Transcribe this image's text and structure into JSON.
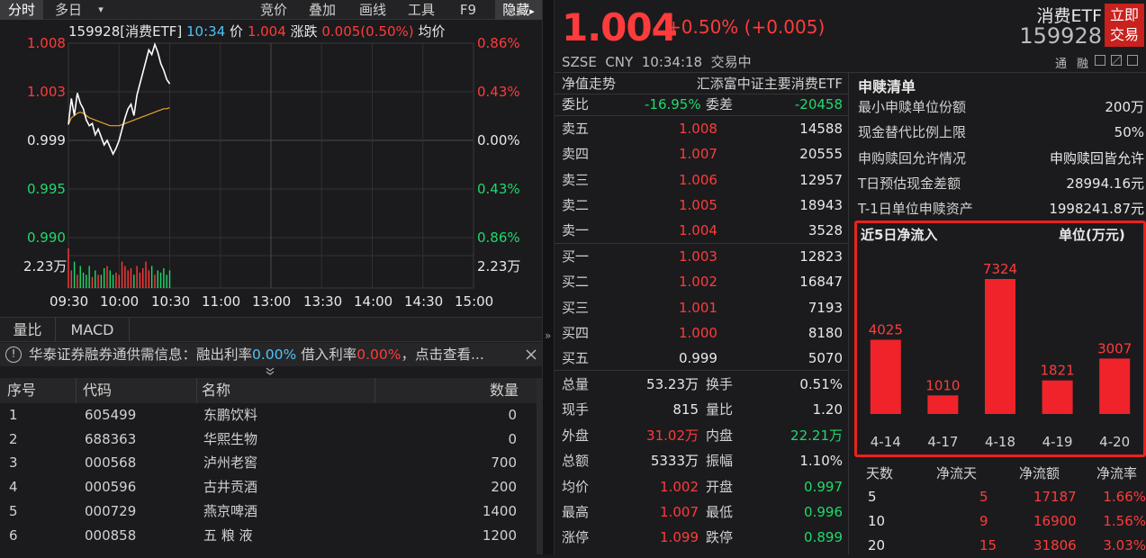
{
  "toolbar": {
    "tab_intraday": "分时",
    "tab_multiday": "多日",
    "dropdown": "▾",
    "items": [
      "竞价",
      "叠加",
      "画线",
      "工具",
      "F9"
    ],
    "hide": "隐藏",
    "hide_arrow": "▸"
  },
  "chart": {
    "title": {
      "code": "159928[消费ETF]",
      "time": "10:34",
      "price_label": "价",
      "price": "1.004",
      "change_label": "涨跌",
      "change": "0.005(0.50%)",
      "avg_label": "均价"
    },
    "y_left": [
      "1.008",
      "1.003",
      "0.999",
      "0.995",
      "0.990"
    ],
    "y_right": [
      "0.86%",
      "0.43%",
      "0.00%",
      "0.43%",
      "0.86%"
    ],
    "vol_label": "2.23万",
    "vol_label_right": "2.23万",
    "x_ticks": [
      "09:30",
      "10:00",
      "10:30",
      "11:00",
      "13:00",
      "13:30",
      "14:00",
      "14:30",
      "15:00"
    ]
  },
  "chart_data": {
    "type": "line",
    "series": [
      {
        "values": [
          1.0004,
          1.0027,
          1.0012,
          1.0032,
          1.0023,
          1.0018,
          1.0008,
          1.0003,
          1.0005,
          0.9995,
          1.0,
          0.9993,
          0.9986,
          0.999,
          0.9984,
          0.9978,
          0.9983,
          0.999,
          1.0,
          1.001,
          1.0018,
          1.0022,
          1.0012,
          1.003,
          1.004,
          1.005,
          1.006,
          1.007,
          1.0066,
          1.0075,
          1.0068,
          1.0058,
          1.0052,
          1.0044,
          1.004
        ]
      },
      {
        "values": [
          1.0004,
          1.001,
          1.0012,
          1.0014,
          1.0015,
          1.0014,
          1.0012,
          1.001,
          1.0009,
          1.0008,
          1.0007,
          1.0006,
          1.0005,
          1.0004,
          1.0003,
          1.0003,
          1.0003,
          1.0003,
          1.0004,
          1.0005,
          1.0006,
          1.0007,
          1.0008,
          1.0009,
          1.001,
          1.0011,
          1.0012,
          1.0013,
          1.0014,
          1.0015,
          1.0016,
          1.0017,
          1.0018,
          1.0018,
          1.0019
        ]
      }
    ],
    "volume": [
      0.9,
      0.4,
      0.6,
      0.3,
      0.5,
      0.35,
      0.3,
      0.5,
      0.25,
      0.4,
      0.3,
      0.3,
      0.45,
      0.5,
      0.4,
      0.3,
      0.35,
      0.3,
      0.6,
      0.5,
      0.4,
      0.45,
      0.3,
      0.5,
      0.35,
      0.45,
      0.6,
      0.4,
      0.5,
      0.3,
      0.4,
      0.35,
      0.45,
      0.3,
      0.4
    ],
    "ylim": [
      0.9904,
      1.0076
    ],
    "prev_close": 0.999,
    "x_range": [
      "09:30",
      "15:00"
    ]
  },
  "indicator_tabs": [
    "量比",
    "MACD"
  ],
  "notice": {
    "icon": "!",
    "text1": "华泰证券融券通供需信息：融出利率",
    "rate1": "0.00%",
    "text2": "借入利率",
    "rate2": "0.00%",
    "text3": "，点击查看..."
  },
  "table": {
    "headers": [
      "序号",
      "代码",
      "名称",
      "数量"
    ],
    "rows": [
      [
        "1",
        "605499",
        "东鹏饮料",
        "0"
      ],
      [
        "2",
        "688363",
        "华熙生物",
        "0"
      ],
      [
        "3",
        "000568",
        "泸州老窖",
        "700"
      ],
      [
        "4",
        "000596",
        "古井贡酒",
        "200"
      ],
      [
        "5",
        "000729",
        "燕京啤酒",
        "1400"
      ],
      [
        "6",
        "000858",
        "五 粮 液",
        "1200"
      ]
    ]
  },
  "quote": {
    "price": "1.004",
    "change": "+0.50% (+0.005)",
    "name": "消费ETF",
    "code": "159928",
    "trade_btn": [
      "立即",
      "交易"
    ],
    "meta": "SZSE  CNY  10:34:18  交易中",
    "tags": [
      "通",
      "融"
    ]
  },
  "orderbook": {
    "nav_label": "净值走势",
    "fund_name": "汇添富中证主要消费ETF",
    "weibi_label": "委比",
    "weibi": "-16.95%",
    "weicha_label": "委差",
    "weicha": "-20458",
    "asks": [
      [
        "卖五",
        "1.008",
        "14588"
      ],
      [
        "卖四",
        "1.007",
        "20555"
      ],
      [
        "卖三",
        "1.006",
        "12957"
      ],
      [
        "卖二",
        "1.005",
        "18943"
      ],
      [
        "卖一",
        "1.004",
        "3528"
      ]
    ],
    "bids": [
      [
        "买一",
        "1.003",
        "12823"
      ],
      [
        "买二",
        "1.002",
        "16847"
      ],
      [
        "买三",
        "1.001",
        "7193"
      ],
      [
        "买四",
        "1.000",
        "8180"
      ],
      [
        "买五",
        "0.999",
        "5070"
      ]
    ],
    "stats": [
      [
        "总量",
        "53.23万",
        "white",
        "换手",
        "0.51%",
        "white"
      ],
      [
        "现手",
        "815",
        "white",
        "量比",
        "1.20",
        "white"
      ],
      [
        "外盘",
        "31.02万",
        "red",
        "内盘",
        "22.21万",
        "green"
      ],
      [
        "总额",
        "5333万",
        "white",
        "振幅",
        "1.10%",
        "white"
      ],
      [
        "均价",
        "1.002",
        "red",
        "开盘",
        "0.997",
        "green"
      ],
      [
        "最高",
        "1.007",
        "red",
        "最低",
        "0.996",
        "green"
      ],
      [
        "涨停",
        "1.099",
        "red",
        "跌停",
        "0.899",
        "green"
      ]
    ]
  },
  "redemption": {
    "title": "申赎清单",
    "rows": [
      [
        "最小申赎单位份额",
        "200万"
      ],
      [
        "现金替代比例上限",
        "50%"
      ],
      [
        "申购赎回允许情况",
        "申购赎回皆允许"
      ],
      [
        "T日预估现金差额",
        "28994.16元"
      ],
      [
        "T-1日单位申赎资产",
        "1998241.87元"
      ]
    ]
  },
  "inflow": {
    "title": "近5日净流入",
    "unit": "单位(万元)",
    "bar_color": "#f0232b",
    "chart_data": {
      "type": "bar",
      "categories": [
        "4-14",
        "4-17",
        "4-18",
        "4-19",
        "4-20"
      ],
      "values": [
        4025,
        1010,
        7324,
        1821,
        3007
      ],
      "ylim": [
        0,
        7324
      ]
    }
  },
  "netflow": {
    "headers": [
      "天数",
      "净流天",
      "净流额",
      "净流率"
    ],
    "rows": [
      [
        "5",
        "5",
        "17187",
        "1.66%"
      ],
      [
        "10",
        "9",
        "16900",
        "1.56%"
      ],
      [
        "20",
        "15",
        "31806",
        "3.03%"
      ]
    ]
  },
  "colors": {
    "up": "#ff3b3b",
    "down": "#1fd96b",
    "bg": "#1b1b1d",
    "price_line": "#ffffff",
    "avg_line": "#e8a32b",
    "highlight_box": "#e8231f"
  }
}
